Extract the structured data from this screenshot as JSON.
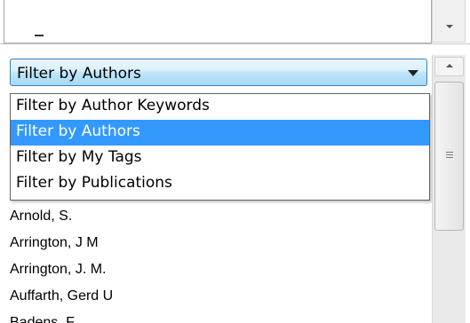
{
  "filter_select": {
    "selected_label": "Filter by Authors",
    "options": [
      {
        "label": "Filter by Author Keywords",
        "selected": false
      },
      {
        "label": "Filter by Authors",
        "selected": true
      },
      {
        "label": "Filter by My Tags",
        "selected": false
      },
      {
        "label": "Filter by Publications",
        "selected": false
      }
    ]
  },
  "author_list": {
    "items": [
      "Arnold, S.",
      "Arrington, J M",
      "Arrington, J. M.",
      "Auffarth, Gerd U",
      "Badens, F"
    ]
  },
  "colors": {
    "selected_option_bg": "#3399ff",
    "combo_border": "#3c7fb1"
  }
}
